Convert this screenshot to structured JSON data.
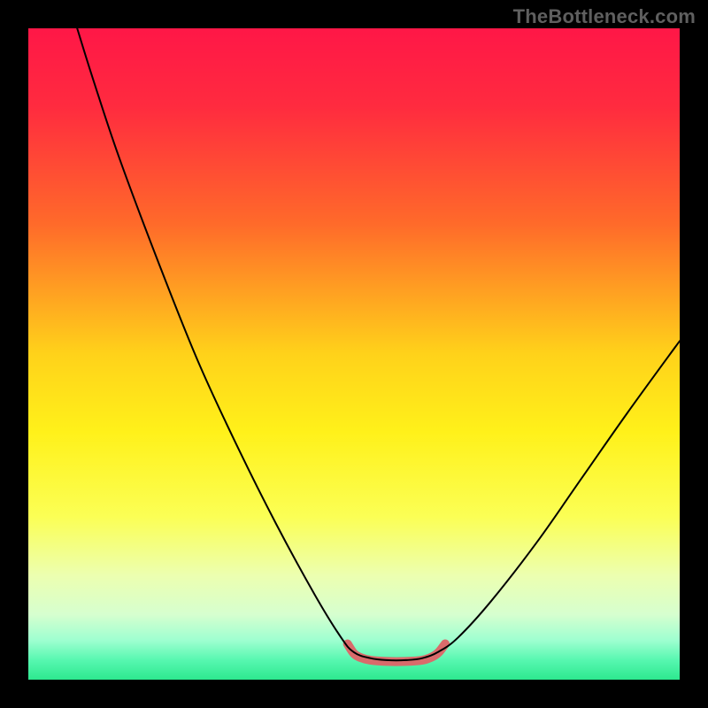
{
  "watermark": "TheBottleneck.com",
  "chart_data": {
    "type": "line",
    "title": "",
    "xlabel": "",
    "ylabel": "",
    "xlim": [
      0,
      100
    ],
    "ylim": [
      0,
      100
    ],
    "gradient_stops": [
      {
        "offset": 0,
        "color": "#ff1747"
      },
      {
        "offset": 12,
        "color": "#ff2b3f"
      },
      {
        "offset": 30,
        "color": "#ff6a2a"
      },
      {
        "offset": 50,
        "color": "#ffd21a"
      },
      {
        "offset": 62,
        "color": "#fff11a"
      },
      {
        "offset": 75,
        "color": "#fbff55"
      },
      {
        "offset": 84,
        "color": "#ecffb0"
      },
      {
        "offset": 90,
        "color": "#d6ffcf"
      },
      {
        "offset": 94,
        "color": "#9dffd0"
      },
      {
        "offset": 97,
        "color": "#57f7b0"
      },
      {
        "offset": 100,
        "color": "#2de88f"
      }
    ],
    "series": [
      {
        "name": "bottleneck-curve",
        "color": "#000000",
        "width": 2,
        "points": [
          {
            "x": 7.5,
            "y": 100
          },
          {
            "x": 10,
            "y": 92
          },
          {
            "x": 14,
            "y": 80
          },
          {
            "x": 20,
            "y": 64
          },
          {
            "x": 26,
            "y": 49
          },
          {
            "x": 32,
            "y": 36
          },
          {
            "x": 38,
            "y": 24
          },
          {
            "x": 44,
            "y": 13
          },
          {
            "x": 48,
            "y": 6.5
          },
          {
            "x": 50,
            "y": 4.2
          },
          {
            "x": 52.5,
            "y": 3.3
          },
          {
            "x": 55,
            "y": 3.0
          },
          {
            "x": 58,
            "y": 3.0
          },
          {
            "x": 60.5,
            "y": 3.3
          },
          {
            "x": 63,
            "y": 4.3
          },
          {
            "x": 66,
            "y": 6.5
          },
          {
            "x": 71,
            "y": 12
          },
          {
            "x": 78,
            "y": 21
          },
          {
            "x": 85,
            "y": 31
          },
          {
            "x": 92,
            "y": 41
          },
          {
            "x": 100,
            "y": 52
          }
        ]
      },
      {
        "name": "optimal-zone",
        "color": "#d96b6b",
        "width": 10,
        "points": [
          {
            "x": 49,
            "y": 5.5
          },
          {
            "x": 50,
            "y": 4.0
          },
          {
            "x": 51,
            "y": 3.4
          },
          {
            "x": 52.5,
            "y": 3.0
          },
          {
            "x": 55,
            "y": 2.8
          },
          {
            "x": 58,
            "y": 2.8
          },
          {
            "x": 60.5,
            "y": 3.0
          },
          {
            "x": 62,
            "y": 3.5
          },
          {
            "x": 63,
            "y": 4.2
          },
          {
            "x": 64,
            "y": 5.5
          }
        ]
      }
    ]
  }
}
